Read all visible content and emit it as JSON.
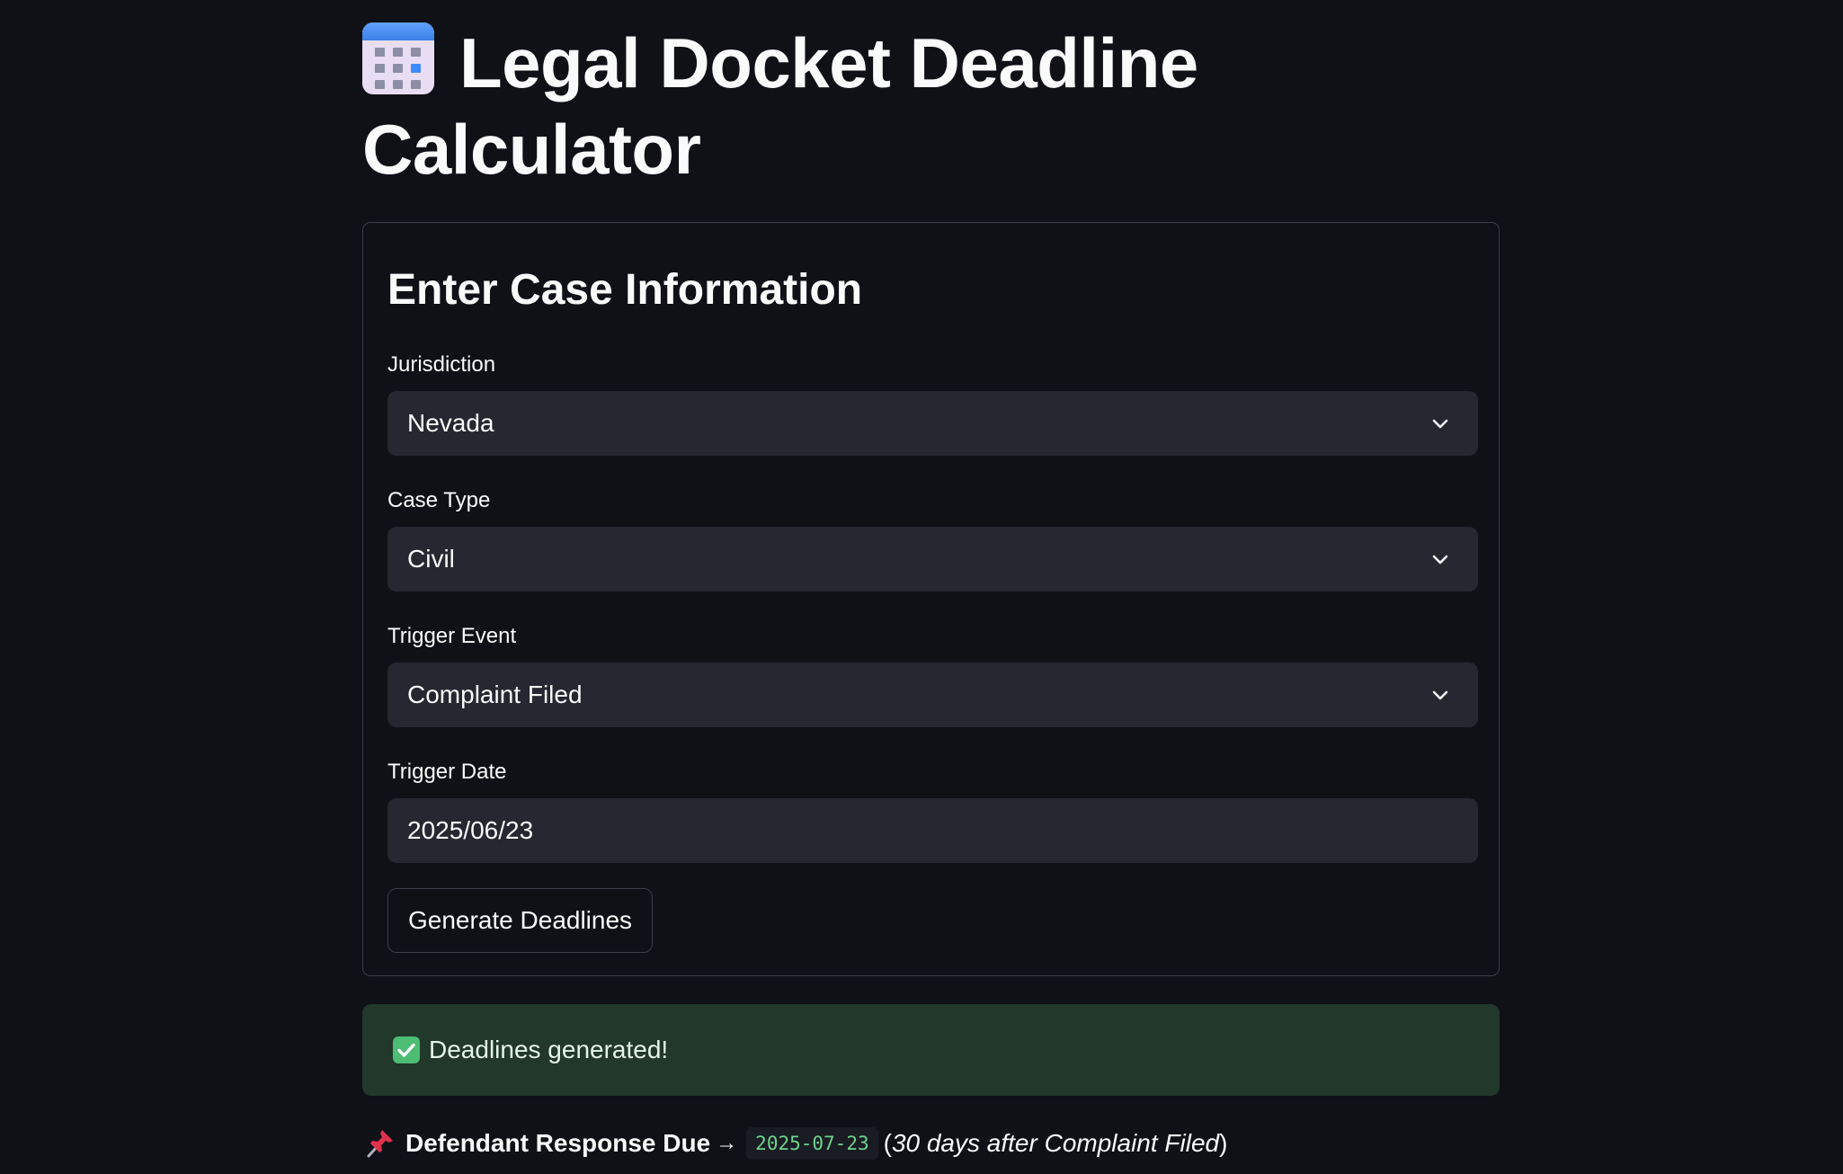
{
  "page": {
    "title": "Legal Docket Deadline Calculator",
    "title_icon": "calendar-icon"
  },
  "form": {
    "heading": "Enter Case Information",
    "jurisdiction": {
      "label": "Jurisdiction",
      "value": "Nevada"
    },
    "case_type": {
      "label": "Case Type",
      "value": "Civil"
    },
    "trigger_event": {
      "label": "Trigger Event",
      "value": "Complaint Filed"
    },
    "trigger_date": {
      "label": "Trigger Date",
      "value": "2025/06/23"
    },
    "submit_label": "Generate Deadlines"
  },
  "alert": {
    "icon": "check-icon",
    "text": "Deadlines generated!",
    "color": "#21382b"
  },
  "deadlines": [
    {
      "icon": "pushpin-icon",
      "name": "Defendant Response Due",
      "arrow": "→",
      "date": "2025-07-23",
      "open_paren": "(",
      "note": "30 days after Complaint Filed",
      "close_paren": ")"
    }
  ]
}
